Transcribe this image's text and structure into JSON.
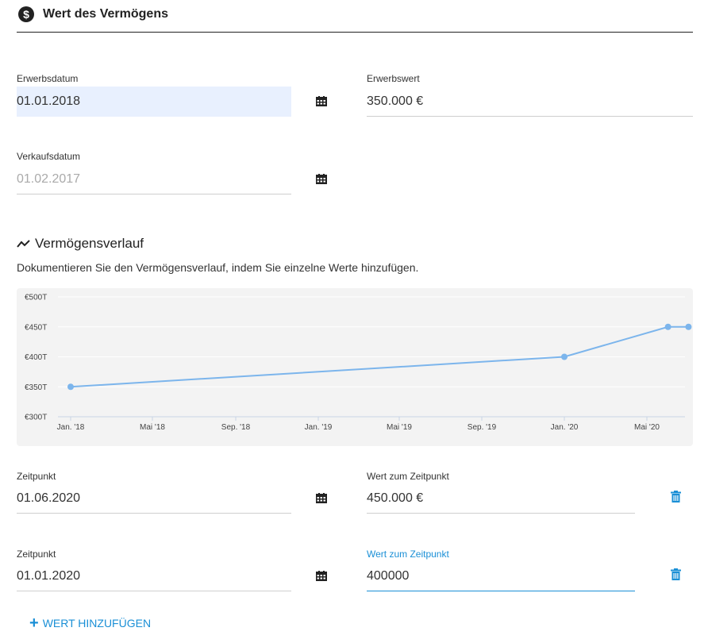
{
  "header": {
    "title": "Wert des Vermögens",
    "icon": "dollar-circle-icon"
  },
  "acquisition": {
    "date_label": "Erwerbsdatum",
    "date_value": "01.01.2018",
    "value_label": "Erwerbswert",
    "value_value": "350.000 €"
  },
  "sale": {
    "date_label": "Verkaufsdatum",
    "date_value": "01.02.2017"
  },
  "history": {
    "title": "Vermögensverlauf",
    "description": "Dokumentieren Sie den Vermögensverlauf, indem Sie einzelne Werte hinzufügen."
  },
  "chart_data": {
    "type": "line",
    "y_tick_labels": [
      "€500T",
      "€450T",
      "€400T",
      "€350T",
      "€300T"
    ],
    "y_ticks": [
      500000,
      450000,
      400000,
      350000,
      300000
    ],
    "x_tick_labels": [
      "Jan. '18",
      "Mai '18",
      "Sep. '18",
      "Jan. '19",
      "Mai '19",
      "Sep. '19",
      "Jan. '20",
      "Mai '20"
    ],
    "ylim": [
      300000,
      500000
    ],
    "points": [
      {
        "x": "2018-01-01",
        "y": 350000
      },
      {
        "x": "2020-01-01",
        "y": 400000
      },
      {
        "x": "2020-06-01",
        "y": 450000
      },
      {
        "x": "2020-07-01",
        "y": 450000
      }
    ],
    "line_color": "#7cb5ec",
    "grid": true
  },
  "entries": [
    {
      "date_label": "Zeitpunkt",
      "date_value": "01.06.2020",
      "value_label": "Wert zum Zeitpunkt",
      "value_value": "450.000 €"
    },
    {
      "date_label": "Zeitpunkt",
      "date_value": "01.01.2020",
      "value_label": "Wert zum Zeitpunkt",
      "value_value": "400000"
    }
  ],
  "add_button": {
    "label": "WERT HINZUFÜGEN"
  },
  "colors": {
    "accent": "#1a8fd6",
    "highlight": "#e8f0fe",
    "chart_line": "#7cb5ec"
  }
}
